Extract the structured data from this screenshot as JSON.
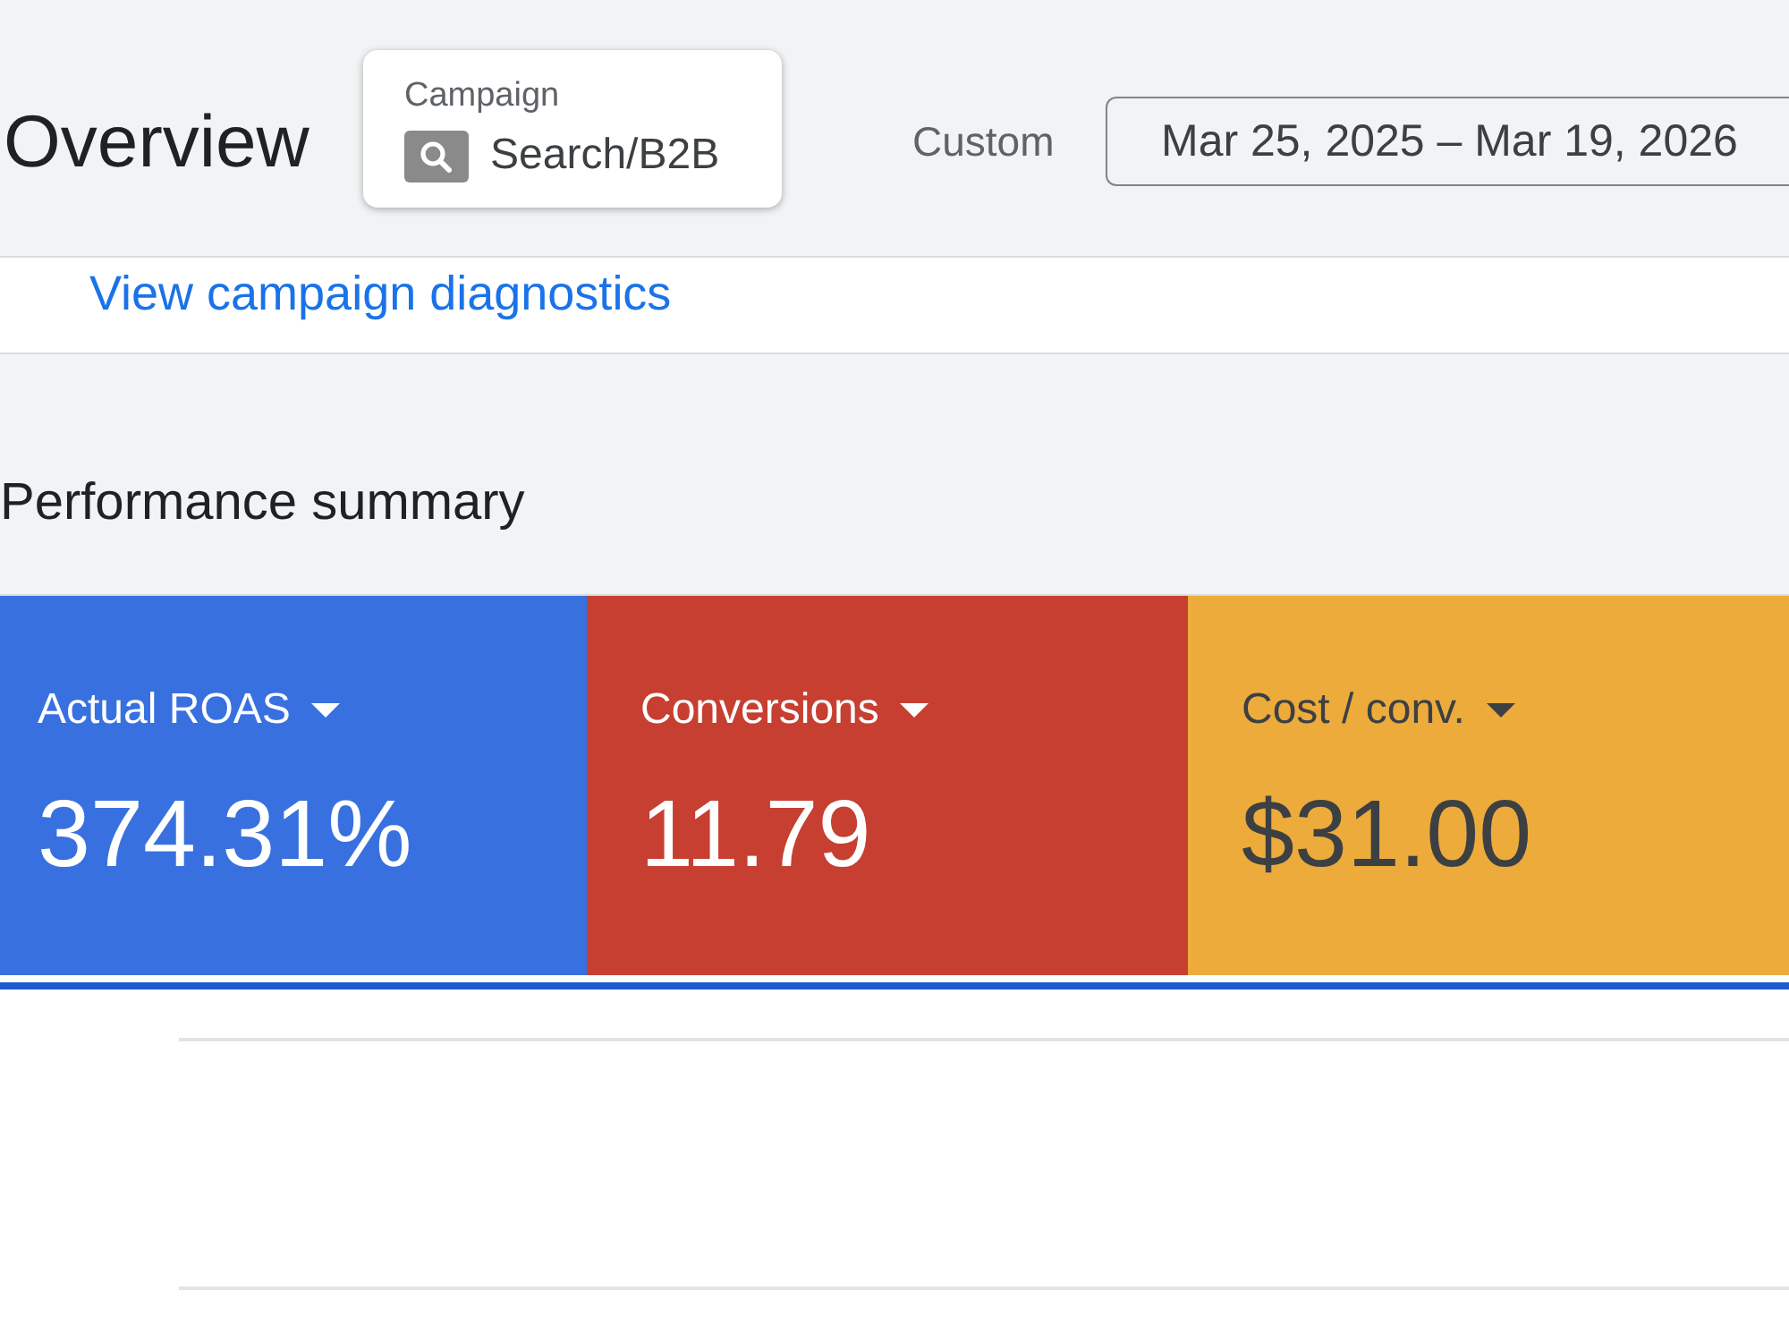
{
  "page": {
    "title": "Overview"
  },
  "campaign_selector": {
    "label": "Campaign",
    "value": "Search/B2B"
  },
  "date_range": {
    "preset": "Custom",
    "value": "Mar 25, 2025 – Mar 19, 2026"
  },
  "diagnostics": {
    "link": "View campaign diagnostics"
  },
  "performance_summary": {
    "title": "Performance summary",
    "metrics": [
      {
        "name": "Actual ROAS",
        "value": "374.31%",
        "color": "#3871df",
        "selected": true
      },
      {
        "name": "Conversions",
        "value": "11.79",
        "color": "#c63f31",
        "selected": true
      },
      {
        "name": "Cost / conv.",
        "value": "$31.00",
        "color": "#edab3c",
        "selected": true
      }
    ]
  }
}
